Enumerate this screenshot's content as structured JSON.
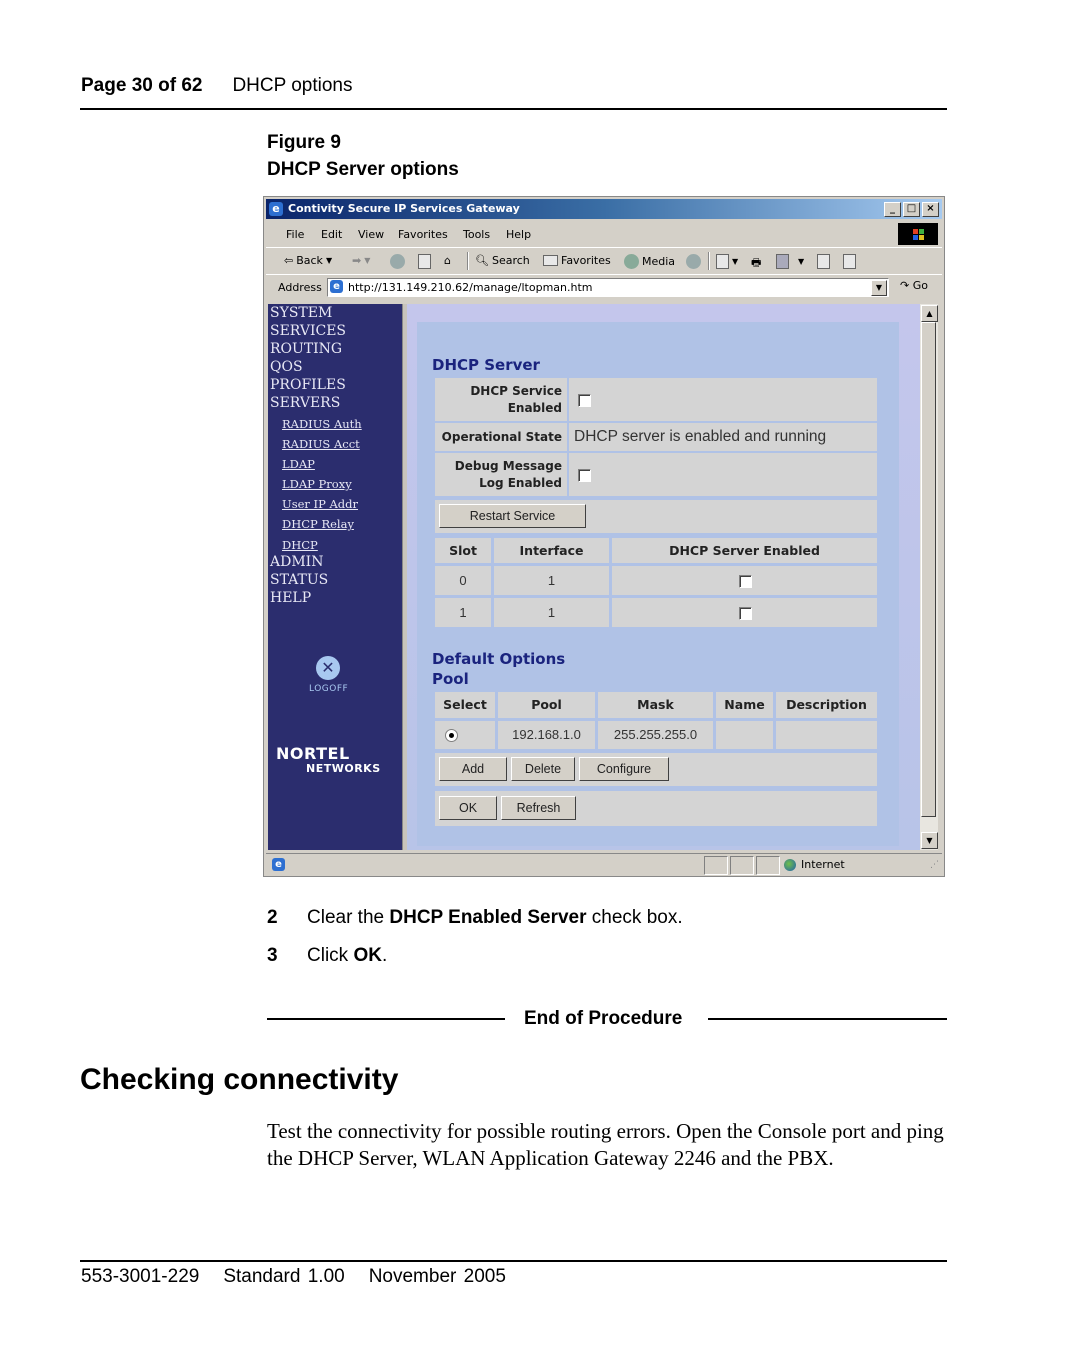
{
  "page_header": {
    "page": "Page 30 of 62",
    "section": "DHCP options"
  },
  "figure": {
    "number": "Figure 9",
    "caption": "DHCP Server options"
  },
  "browser": {
    "title": "Contivity Secure IP Services Gateway",
    "menu": [
      "File",
      "Edit",
      "View",
      "Favorites",
      "Tools",
      "Help"
    ],
    "toolbar": {
      "back": "Back",
      "search": "Search",
      "favorites": "Favorites",
      "media": "Media"
    },
    "address_label": "Address",
    "address": "http://131.149.210.62/manage/ltopman.htm",
    "go": "Go",
    "status_zone": "Internet"
  },
  "sidebar": {
    "nav_top": [
      "SYSTEM",
      "SERVICES",
      "ROUTING",
      "QOS",
      "PROFILES",
      "SERVERS"
    ],
    "servers_sub": [
      "RADIUS Auth",
      "RADIUS Acct",
      "LDAP",
      "LDAP Proxy",
      "User IP Addr",
      "DHCP Relay",
      "DHCP"
    ],
    "nav_bottom": [
      "ADMIN",
      "STATUS",
      "HELP"
    ],
    "logoff": "LOGOFF",
    "brand_line1": "NORTEL",
    "brand_line2": "NETWORKS"
  },
  "dhcp_server": {
    "title": "DHCP Server",
    "service_enabled_label": "DHCP Service Enabled",
    "service_enabled": false,
    "operational_state_label": "Operational State",
    "operational_state": "DHCP server is enabled and running",
    "debug_label": "Debug Message Log Enabled",
    "debug_enabled": false,
    "restart_button": "Restart Service",
    "slot_table": {
      "headers": [
        "Slot",
        "Interface",
        "DHCP Server Enabled"
      ],
      "rows": [
        {
          "slot": "0",
          "interface": "1",
          "enabled": false
        },
        {
          "slot": "1",
          "interface": "1",
          "enabled": false
        }
      ]
    }
  },
  "default_options": {
    "title": "Default Options",
    "pool_title": "Pool",
    "pool_table": {
      "headers": [
        "Select",
        "Pool",
        "Mask",
        "Name",
        "Description"
      ],
      "rows": [
        {
          "selected": true,
          "pool": "192.168.1.0",
          "mask": "255.255.255.0",
          "name": "",
          "description": ""
        }
      ]
    },
    "buttons": {
      "add": "Add",
      "delete": "Delete",
      "configure": "Configure",
      "ok": "OK",
      "refresh": "Refresh"
    }
  },
  "steps": [
    {
      "num": "2",
      "pre": "Clear the ",
      "bold": "DHCP Enabled Server",
      "post": " check box."
    },
    {
      "num": "3",
      "pre": "Click ",
      "bold": "OK",
      "post": "."
    }
  ],
  "end_of_procedure": "End of Procedure",
  "section_heading": "Checking connectivity",
  "paragraph": "Test the connectivity for possible routing errors. Open the Console port and ping the DHCP Server, WLAN Application Gateway 2246 and the PBX.",
  "footer": {
    "doc_number": "553-3001-229",
    "standard": "Standard 1.00",
    "date": "November 2005"
  }
}
